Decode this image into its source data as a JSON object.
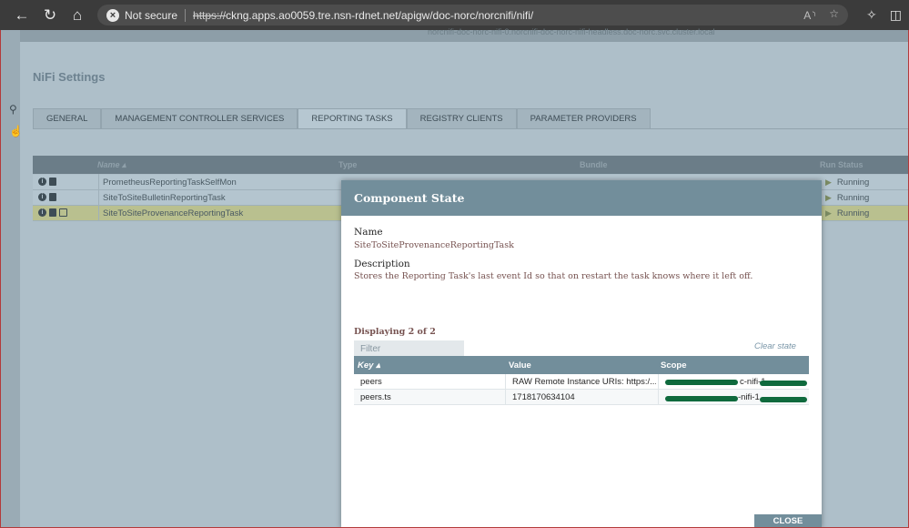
{
  "browser": {
    "back_icon": "arrow-left-icon",
    "reload_icon": "reload-icon",
    "home_icon": "home-icon",
    "not_secure_label": "Not secure",
    "url_scheme": "https://",
    "url_rest": "ckng.apps.ao0059.tre.nsn-rdnet.net/apigw/doc-norc/norcnifi/nifi/"
  },
  "background": {
    "host_text": "norcnifi-doc-norc-nifi-0.norcnifi-doc-norc-nifi-headless.doc-norc.svc.cluster.local",
    "settings_title": "NiFi Settings",
    "tabs": [
      {
        "label": "GENERAL"
      },
      {
        "label": "MANAGEMENT CONTROLLER SERVICES"
      },
      {
        "label": "REPORTING TASKS"
      },
      {
        "label": "REGISTRY CLIENTS"
      },
      {
        "label": "PARAMETER PROVIDERS"
      }
    ],
    "grid": {
      "columns": {
        "name": "Name ▴",
        "type": "Type",
        "bundle": "Bundle",
        "run_status": "Run Status"
      },
      "rows": [
        {
          "name": "PrometheusReportingTaskSelfMon",
          "status": "Running"
        },
        {
          "name": "SiteToSiteBulletinReportingTask",
          "status": "Running"
        },
        {
          "name": "SiteToSiteProvenanceReportingTask",
          "status": "Running"
        }
      ]
    }
  },
  "dialog": {
    "title": "Component State",
    "name_label": "Name",
    "name_value": "SiteToSiteProvenanceReportingTask",
    "description_label": "Description",
    "description_value": "Stores the Reporting Task's last event Id so that on restart the task knows where it left off.",
    "displaying": "Displaying 2 of 2",
    "filter_placeholder": "Filter",
    "clear_state": "Clear state",
    "table": {
      "columns": {
        "key": "Key ▴",
        "value": "Value",
        "scope": "Scope"
      },
      "rows": [
        {
          "key": "peers",
          "value": "RAW Remote Instance URIs: https:/...",
          "scope_partial": "c-nifi-1."
        },
        {
          "key": "peers.ts",
          "value": "1718170634104",
          "scope_partial": "-nifi-1."
        }
      ]
    },
    "close_label": "CLOSE"
  }
}
